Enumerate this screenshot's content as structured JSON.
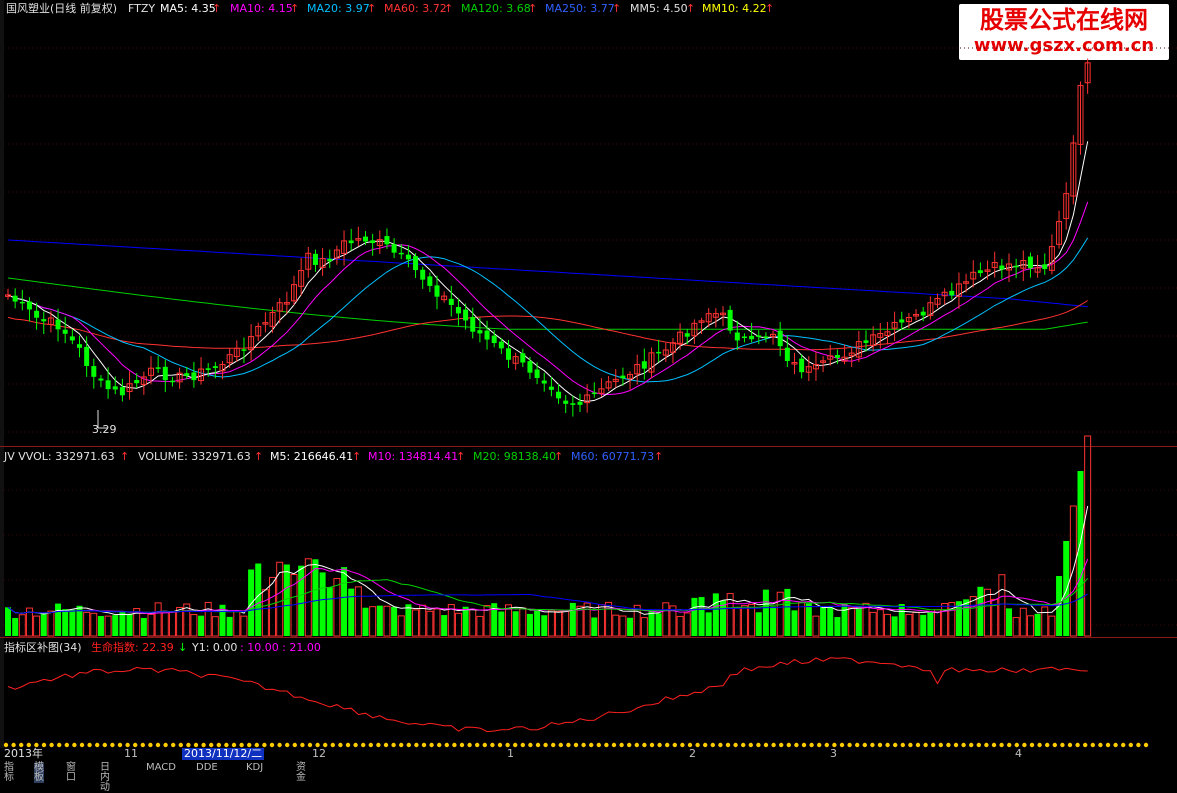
{
  "main_header": {
    "title": "国风塑业(日线 前复权)",
    "indicator": "FTZY",
    "ma5": "MA5: 4.35",
    "ma10": "MA10: 4.15",
    "ma20": "MA20: 3.97",
    "ma60": "MA60: 3.72",
    "ma120": "MA120: 3.68",
    "ma250": "MA250: 3.77",
    "mm5": "MM5: 4.50",
    "mm10": "MM10: 4.22",
    "up_arrow": "↑",
    "low_label": "3.29"
  },
  "brand": {
    "line1": "股票公式在线网",
    "line2": "www.gszx.com.cn"
  },
  "volume_header": {
    "jv": "JV VVOL: 332971.63",
    "volume": "VOLUME: 332971.63",
    "m5": "M5: 216646.41",
    "m10": "M10: 134814.41",
    "m20": "M20: 98138.40",
    "m60": "M60: 60771.73",
    "up_arrow": "↑"
  },
  "indicator_header": {
    "title": "指标区补图(34)",
    "life_index": "生命指数: 22.39",
    "down_arrow": "↓",
    "y1": "Y1: 0.00",
    "levels": ": 10.00 : 21.00"
  },
  "axis": {
    "year": "2013年",
    "nov": "11",
    "cursor_date": "2013/11/12/二",
    "dec": "12",
    "jan": "1",
    "feb": "2",
    "mar": "3",
    "apr": "4"
  },
  "tabs": [
    "指标",
    "模板",
    "窗口",
    "日内动",
    "MACD",
    "DDE",
    "KDJ",
    "资金"
  ],
  "colors": {
    "background": "#000000",
    "up": "#ff3232",
    "down": "#00ff00",
    "ma5": "#ffffff",
    "ma10": "#ff00ff",
    "ma20": "#00c0ff",
    "ma60": "#ff3232",
    "ma120": "#00d000",
    "ma250": "#0000ff",
    "life_index": "#ff2020",
    "header_yellow": "#ffff00",
    "header_white": "#ffffff"
  }
}
